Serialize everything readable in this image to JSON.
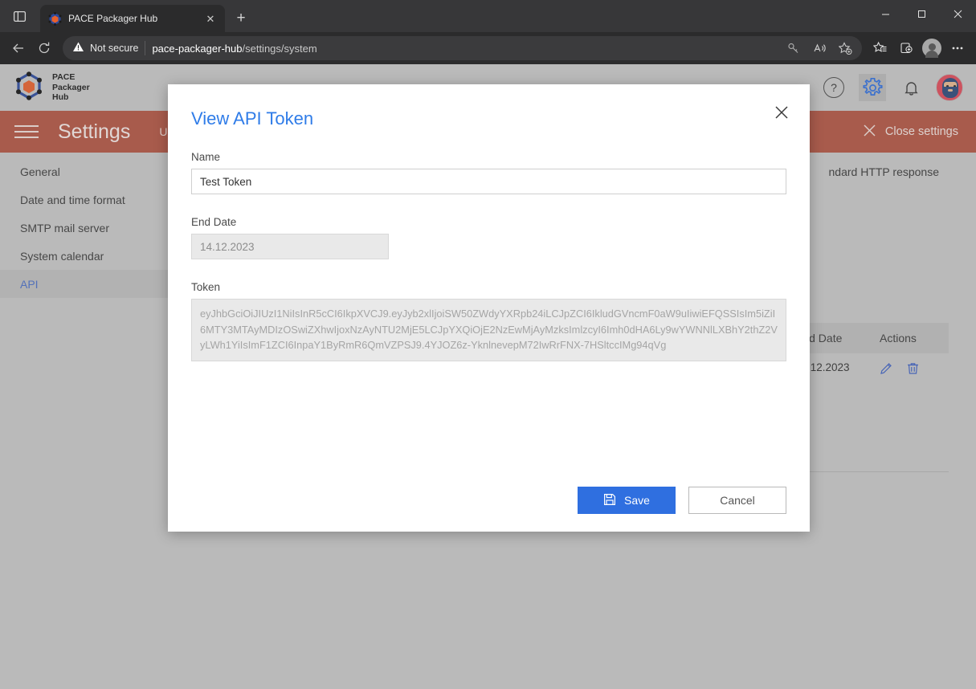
{
  "browser": {
    "tab": {
      "title": "PACE Packager Hub",
      "favicon_icon": "pace-cube-icon",
      "close_icon": "close-icon"
    },
    "new_tab_icon": "plus-icon",
    "tab_sidebar_icon": "tab-sidebar-icon",
    "window_controls": {
      "minimize": "minimize-icon",
      "maximize": "maximize-icon",
      "close": "close-icon"
    },
    "toolbar": {
      "back_icon": "back-arrow-icon",
      "reload_icon": "reload-icon",
      "security_label": "Not secure",
      "security_icon": "warning-triangle-icon",
      "url_host": "pace-packager-hub",
      "url_path": "/settings/system",
      "icons": [
        "key-icon",
        "read-aloud-icon",
        "add-favorite-icon",
        "favorites-icon",
        "collections-icon",
        "profile-icon",
        "more-icon"
      ]
    }
  },
  "app": {
    "brand": {
      "line1": "PACE",
      "line2": "Packager",
      "line3": "Hub",
      "logo_icon": "pace-cube-logo"
    },
    "header_icons": [
      {
        "name": "help-icon",
        "glyph": "?"
      },
      {
        "name": "settings-gear-icon",
        "glyph": ""
      },
      {
        "name": "notifications-bell-icon",
        "glyph": ""
      },
      {
        "name": "user-avatar",
        "glyph": ""
      }
    ],
    "settings_bar": {
      "menu_icon": "hamburger-menu-icon",
      "title": "Settings",
      "tabs": [
        "U"
      ],
      "close_label": "Close settings",
      "close_icon": "close-icon",
      "bg_color": "#b35543"
    },
    "sidebar": {
      "items": [
        {
          "label": "General",
          "active": false
        },
        {
          "label": "Date and time format",
          "active": false
        },
        {
          "label": "SMTP mail server",
          "active": false
        },
        {
          "label": "System calendar",
          "active": false
        },
        {
          "label": "API",
          "active": true
        }
      ]
    },
    "content": {
      "description_fragment": "ndard HTTP response",
      "table": {
        "headers": [
          "",
          "",
          "End Date",
          "Actions"
        ],
        "rows": [
          {
            "token": "QiOjE2NzEwMjAyMzksImIzcyI6Imh0dHA6Ly9wYWNNlLXBhY2thZ2VyLWh1YiIsImF1ZCI6InpaY1ByRmR6QmVZPSJ9.4YJOZ6z-YknlnevepM72IwRrFNX-7HSltccIMg94qVg",
            "end_date": "14.12.2023",
            "edit_icon": "pencil-icon",
            "delete_icon": "trash-icon"
          }
        ]
      }
    }
  },
  "modal": {
    "title": "View API Token",
    "close_icon": "close-icon",
    "name_label": "Name",
    "name_value": "Test Token",
    "end_date_label": "End Date",
    "end_date_value": "14.12.2023",
    "token_label": "Token",
    "token_value": "eyJhbGciOiJIUzI1NiIsInR5cCI6IkpXVCJ9.eyJyb2xlIjoiSW50ZWdyYXRpb24iLCJpZCI6IkludGVncmF0aW9uIiwiEFQSSIsIm5iZiI6MTY3MTAyMDIzOSwiZXhwIjoxNzAyNTU2MjE5LCJpYXQiOjE2NzEwMjAyMzksImlzcyI6Imh0dHA6Ly9wYWNNlLXBhY2thZ2VyLWh1YiIsImF1ZCI6InpaY1ByRmR6QmVZPSJ9.4YJOZ6z-YknlnevepM72IwRrFNX-7HSltccIMg94qVg",
    "save_label": "Save",
    "save_icon": "save-disk-icon",
    "cancel_label": "Cancel"
  }
}
